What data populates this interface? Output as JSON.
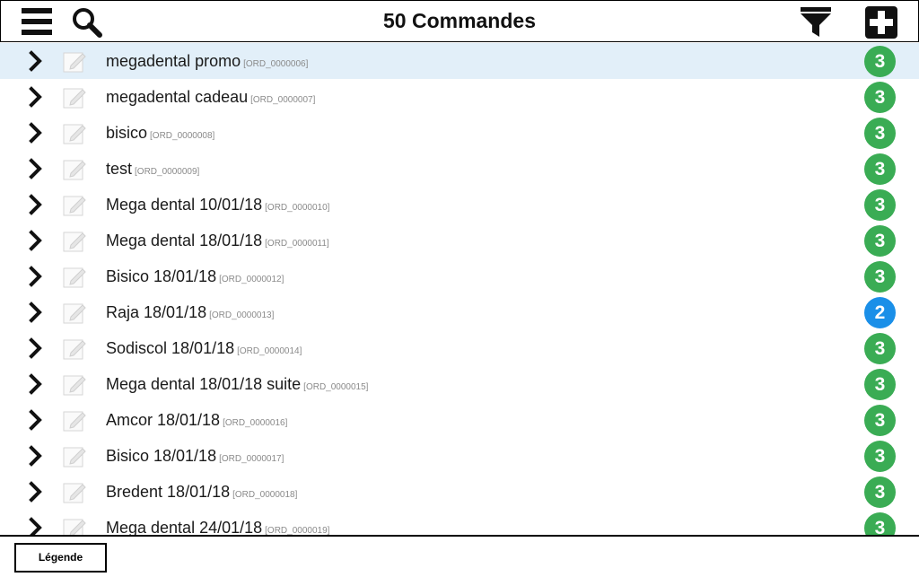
{
  "header": {
    "title": "50 Commandes",
    "menu_icon": "hamburger-menu-icon",
    "search_icon": "search-icon",
    "filter_icon": "filter-icon",
    "add_icon": "plus-icon"
  },
  "colors": {
    "selected_row": "#e2eff9",
    "badge_green": "#3aac54",
    "badge_blue": "#1a8fe8"
  },
  "orders": [
    {
      "name": "megadental promo",
      "code": "[ORD_0000006]",
      "badge": "3",
      "status": "green",
      "selected": true
    },
    {
      "name": "megadental cadeau",
      "code": "[ORD_0000007]",
      "badge": "3",
      "status": "green"
    },
    {
      "name": "bisico",
      "code": "[ORD_0000008]",
      "badge": "3",
      "status": "green"
    },
    {
      "name": "test",
      "code": "[ORD_0000009]",
      "badge": "3",
      "status": "green"
    },
    {
      "name": "Mega dental 10/01/18",
      "code": "[ORD_0000010]",
      "badge": "3",
      "status": "green"
    },
    {
      "name": "Mega dental 18/01/18",
      "code": "[ORD_0000011]",
      "badge": "3",
      "status": "green"
    },
    {
      "name": "Bisico 18/01/18",
      "code": "[ORD_0000012]",
      "badge": "3",
      "status": "green"
    },
    {
      "name": "Raja 18/01/18",
      "code": "[ORD_0000013]",
      "badge": "2",
      "status": "blue"
    },
    {
      "name": "Sodiscol 18/01/18",
      "code": "[ORD_0000014]",
      "badge": "3",
      "status": "green"
    },
    {
      "name": "Mega dental 18/01/18 suite",
      "code": "[ORD_0000015]",
      "badge": "3",
      "status": "green"
    },
    {
      "name": "Amcor 18/01/18",
      "code": "[ORD_0000016]",
      "badge": "3",
      "status": "green"
    },
    {
      "name": "Bisico 18/01/18",
      "code": "[ORD_0000017]",
      "badge": "3",
      "status": "green"
    },
    {
      "name": "Bredent 18/01/18",
      "code": "[ORD_0000018]",
      "badge": "3",
      "status": "green"
    },
    {
      "name": "Mega dental 24/01/18",
      "code": "[ORD_0000019]",
      "badge": "3",
      "status": "green"
    }
  ],
  "footer": {
    "legend_label": "Légende"
  }
}
